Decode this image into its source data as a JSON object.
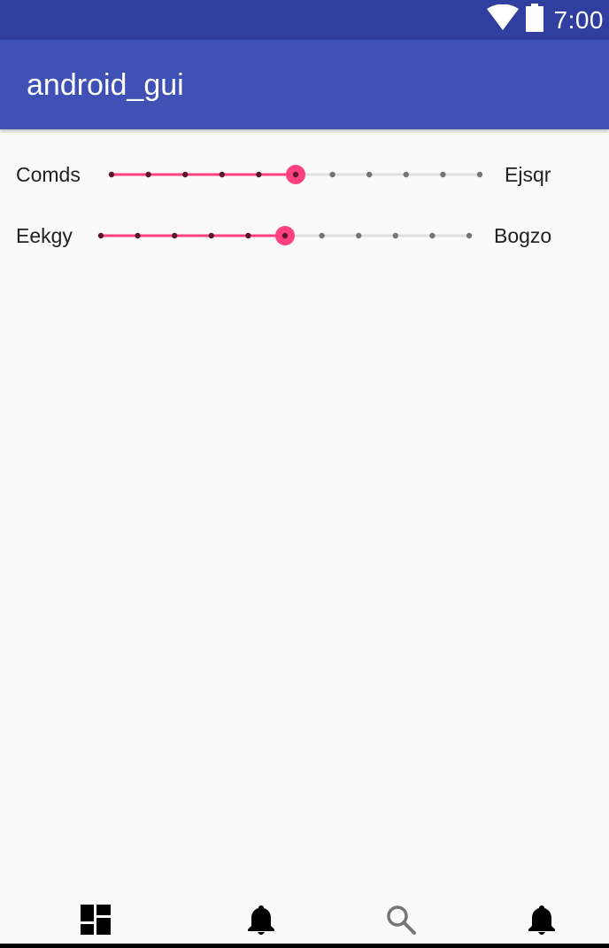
{
  "status_bar": {
    "time": "7:00",
    "icons": [
      "wifi-icon",
      "battery-icon"
    ]
  },
  "app_bar": {
    "title": "android_gui"
  },
  "sliders": [
    {
      "left_label": "Comds",
      "right_label": "Ejsqr",
      "ticks": 11,
      "value_step": 5,
      "fraction": 0.5
    },
    {
      "left_label": "Eekgy",
      "right_label": "Bogzo",
      "ticks": 11,
      "value_step": 5,
      "fraction": 0.5
    }
  ],
  "bottom_nav": {
    "items": [
      {
        "icon": "dashboard-icon"
      },
      {
        "icon": "bell-icon"
      },
      {
        "icon": "search-icon"
      },
      {
        "icon": "bell-icon"
      }
    ]
  },
  "colors": {
    "status_bar": "#303f9f",
    "app_bar": "#3f51b5",
    "accent": "#ff4081",
    "background": "#fafafa"
  }
}
